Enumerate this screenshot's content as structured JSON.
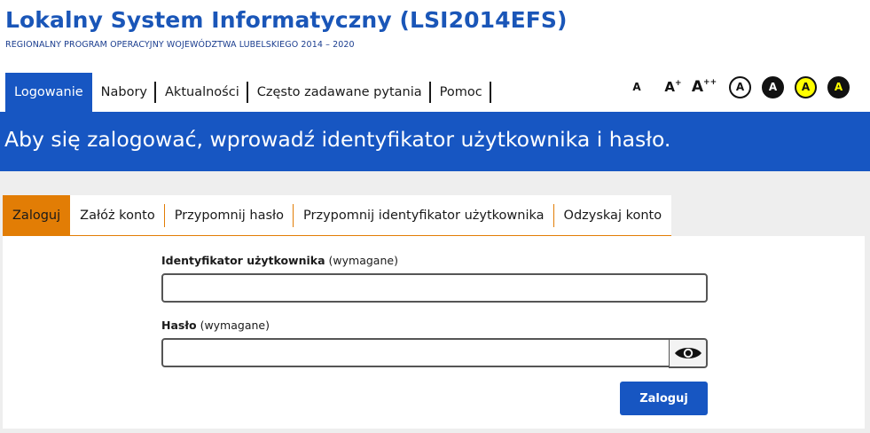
{
  "header": {
    "title": "Lokalny System Informatyczny (LSI2014EFS)",
    "subtitle": "REGIONALNY PROGRAM OPERACYJNY WOJEWÓDZTWA LUBELSKIEGO 2014 – 2020"
  },
  "nav": {
    "items": [
      {
        "label": "Logowanie",
        "active": true
      },
      {
        "label": "Nabory"
      },
      {
        "label": "Aktualności"
      },
      {
        "label": "Często zadawane pytania"
      },
      {
        "label": "Pomoc"
      }
    ]
  },
  "accessibility": {
    "font_small": "A",
    "font_medium": "A",
    "font_medium_sup": "+",
    "font_large": "A",
    "font_large_sup": "++",
    "contrast": [
      {
        "label": "A",
        "bg": "#ffffff",
        "fg": "#111111",
        "border": "#111111"
      },
      {
        "label": "A",
        "bg": "#111111",
        "fg": "#ffffff",
        "border": "#111111"
      },
      {
        "label": "A",
        "bg": "#ffff00",
        "fg": "#111111",
        "border": "#111111"
      },
      {
        "label": "A",
        "bg": "#111111",
        "fg": "#ffff00",
        "border": "#111111"
      }
    ]
  },
  "banner": {
    "text": "Aby się zalogować, wprowadź identyfikator użytkownika i hasło."
  },
  "tabs": [
    {
      "label": "Zaloguj",
      "active": true
    },
    {
      "label": "Załóż konto"
    },
    {
      "label": "Przypomnij hasło"
    },
    {
      "label": "Przypomnij identyfikator użytkownika"
    },
    {
      "label": "Odzyskaj konto"
    }
  ],
  "form": {
    "username_label": "Identyfikator użytkownika",
    "username_required": "(wymagane)",
    "username_value": "",
    "password_label": "Hasło",
    "password_required": "(wymagane)",
    "password_value": "",
    "show_password_icon": "eye-icon",
    "submit_label": "Zaloguj"
  },
  "colors": {
    "primary": "#1756c2",
    "accent": "#e27d05",
    "background_panel": "#eeeeee"
  }
}
